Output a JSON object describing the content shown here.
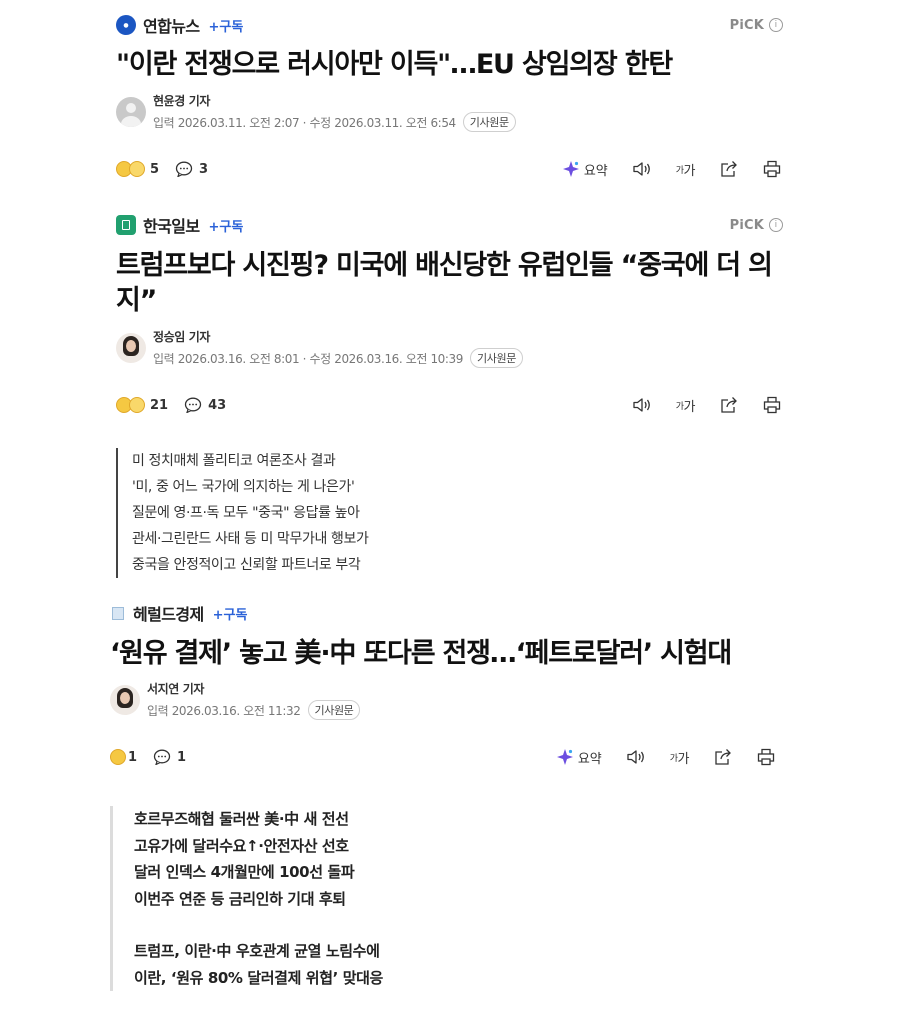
{
  "articles": [
    {
      "press": "연합뉴스",
      "subscribe": "+구독",
      "pick": "PiCK",
      "pick_info": "i",
      "headline": "\"이란 전쟁으로 러시아만 이득\"…EU 상임의장 한탄",
      "reporter": "현윤경 기자",
      "dates": "입력 2026.03.11. 오전 2:07 · 수정 2026.03.11. 오전 6:54",
      "original": "기사원문",
      "reactions": "5",
      "comments": "3",
      "summary_label": "요약",
      "font_label": "가"
    },
    {
      "press": "한국일보",
      "subscribe": "+구독",
      "pick": "PiCK",
      "pick_info": "i",
      "headline": "트럼프보다 시진핑? 미국에 배신당한 유럽인들 “중국에 더 의지”",
      "reporter": "정승임 기자",
      "dates": "입력 2026.03.16. 오전 8:01 · 수정 2026.03.16. 오전 10:39",
      "original": "기사원문",
      "reactions": "21",
      "comments": "43",
      "font_label": "가",
      "summary": [
        "미 정치매체 폴리티코 여론조사 결과",
        "'미, 중 어느 국가에 의지하는 게 나은가'",
        "질문에 영·프·독 모두 \"중국\" 응답률 높아",
        "관세·그린란드 사태 등 미 막무가내 행보가",
        "중국을 안정적이고 신뢰할 파트너로 부각"
      ]
    },
    {
      "press": "헤럴드경제",
      "subscribe": "+구독",
      "headline": "‘원유 결제’ 놓고 美·中 또다른 전쟁…‘페트로달러’ 시험대",
      "reporter": "서지연 기자",
      "dates": "입력 2026.03.16. 오전 11:32",
      "original": "기사원문",
      "reactions": "1",
      "comments": "1",
      "summary_label": "요약",
      "font_label": "가",
      "summary": [
        "호르무즈해협 둘러싼 美·中 새 전선",
        "고유가에 달러수요↑·안전자산 선호",
        "달러 인덱스 4개월만에 100선 돌파",
        "이번주 연준 등 금리인하 기대 후퇴",
        "",
        "트럼프, 이란·中 우호관계 균열 노림수에",
        "이란, ‘원유 80% 달러결제 위협’ 맞대응"
      ]
    }
  ],
  "icons": [
    "reaction-emoji-icon",
    "comment-icon",
    "summary-spark-icon",
    "audio-icon",
    "font-size-icon",
    "share-icon",
    "print-icon",
    "info-icon"
  ],
  "colors": {
    "subscribe": "#2b62d8",
    "yonhap": "#1b56c2",
    "hankook": "#21a06f",
    "summary_spark": "#6c4fe0"
  }
}
